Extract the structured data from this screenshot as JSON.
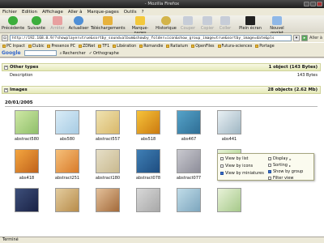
{
  "window": {
    "title": "- Mozilla Firefox"
  },
  "menu": [
    "Fichier",
    "Edition",
    "Affichage",
    "Aller à",
    "Marque-pages",
    "Outils",
    "?"
  ],
  "toolbar": {
    "back": "Précédente",
    "forward": "Suivante",
    "stop": "Arrêter",
    "reload": "Actualiser",
    "downloads": "Téléchargements",
    "bookmarks": "Marque-pages",
    "history": "Historique",
    "cut": "Couper",
    "copy": "Copier",
    "paste": "Coller",
    "fullscreen": "Plein écran",
    "new_tab": "Nouvel onglet"
  },
  "url": {
    "label": "Aller à",
    "value": "http://192.168.0.9/?showplayer=true&sortby_sound=album&showby_folder=icon&show_group_image=true&sortby_image=date&pls"
  },
  "bookmarks": [
    "PC Inpact",
    "Clubic",
    "Presence PC",
    "ZDNet",
    "TF1",
    "Libération",
    "Romandie",
    "Ratiatum",
    "OpenFiles",
    "Futura-sciences",
    "Portage"
  ],
  "google": {
    "logo": "Google",
    "search_label": "Rechercher",
    "spell_label": "Orthographe"
  },
  "sections": {
    "other": {
      "title": "Other types",
      "summary": "1 object (143 Bytes)"
    },
    "description": {
      "label": "Description",
      "size": "143 Bytes"
    },
    "images": {
      "title": "Images",
      "summary": "28 objects (2.62 Mb)"
    }
  },
  "group_date": "20/01/2005",
  "thumbnails": [
    {
      "caption": "abstract580",
      "colors": [
        "#cfe8a5",
        "#8fbf6a"
      ]
    },
    {
      "caption": "abs580",
      "colors": [
        "#d9ecf7",
        "#a7cbe3"
      ]
    },
    {
      "caption": "abstract557",
      "colors": [
        "#efe3b2",
        "#d9b86a"
      ]
    },
    {
      "caption": "abs518",
      "colors": [
        "#f6c33a",
        "#cb7a10"
      ]
    },
    {
      "caption": "abs467",
      "colors": [
        "#55a3c9",
        "#2f6e95"
      ]
    },
    {
      "caption": "abs441",
      "colors": [
        "#e9f0f4",
        "#9fb6c3"
      ]
    },
    {
      "caption": "abs418",
      "colors": [
        "#f4a640",
        "#c0621a"
      ]
    },
    {
      "caption": "abstract251",
      "colors": [
        "#f6c07a",
        "#d87b2a"
      ]
    },
    {
      "caption": "abstract180",
      "colors": [
        "#e6dfc8",
        "#c9b98e"
      ]
    },
    {
      "caption": "abstract078",
      "colors": [
        "#3f7fb5",
        "#1e4d80"
      ]
    },
    {
      "caption": "abstract077",
      "colors": [
        "#c9c9cf",
        "#8d8d99"
      ]
    },
    {
      "caption": "abstract068",
      "colors": [
        "#e9f4d8",
        "#9ccc7a"
      ]
    },
    {
      "caption": "",
      "colors": [
        "#3d4f7a",
        "#1a2245"
      ]
    },
    {
      "caption": "",
      "colors": [
        "#e3cc9e",
        "#b88c4a"
      ]
    },
    {
      "caption": "",
      "colors": [
        "#e3c09a",
        "#a36a3a"
      ]
    },
    {
      "caption": "",
      "colors": [
        "#d8d8d8",
        "#a8a8a8"
      ]
    },
    {
      "caption": "",
      "colors": [
        "#c0dce8",
        "#7da6be"
      ]
    },
    {
      "caption": "",
      "colors": [
        "#e8f2d8",
        "#a6c98a"
      ]
    }
  ],
  "view_menu": {
    "by_list": "View by list",
    "by_icons": "View by icons",
    "by_miniatures": "View by miniatures",
    "display": "Display",
    "sorting": "Sorting",
    "show_by_group": "Show by group",
    "filter_view": "Filter view"
  },
  "status": {
    "text": "Terminé"
  }
}
